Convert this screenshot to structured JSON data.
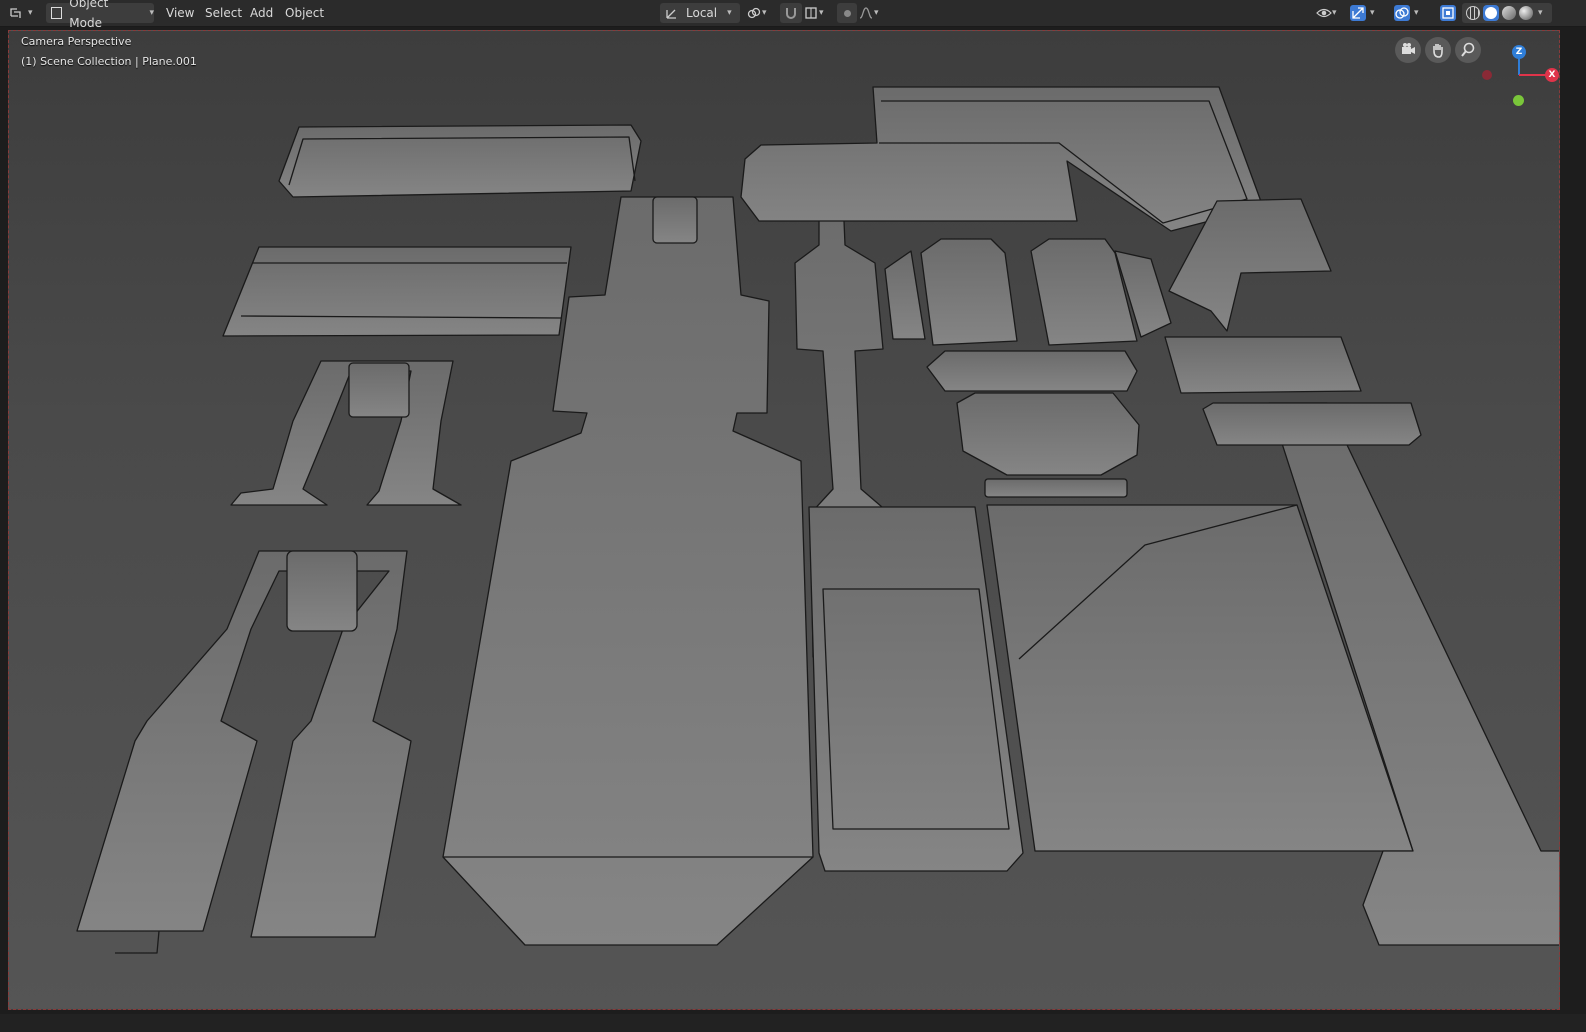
{
  "header": {
    "editor_type_icon": "3d-viewport-icon",
    "mode": "Object Mode",
    "menus": [
      "View",
      "Select",
      "Add",
      "Object"
    ],
    "transform_orientation": "Local",
    "colors": {
      "bg": "#2b2b2b",
      "text": "#d9d9d9",
      "active_blue": "#3d7ad4"
    }
  },
  "viewport": {
    "overlay_line1": "Camera Perspective",
    "overlay_line2": "(1) Scene Collection | Plane.001",
    "gizmo": {
      "z_label": "Z",
      "x_label": "X",
      "z_color": "#2f7ed8",
      "x_color": "#e0344a",
      "y_color": "#7ac63a"
    },
    "nav_icons": [
      "camera-view-icon",
      "hand-pan-icon",
      "zoom-icon"
    ],
    "mesh_colors": {
      "face": "#777777",
      "edge": "#1a1a1a"
    }
  }
}
